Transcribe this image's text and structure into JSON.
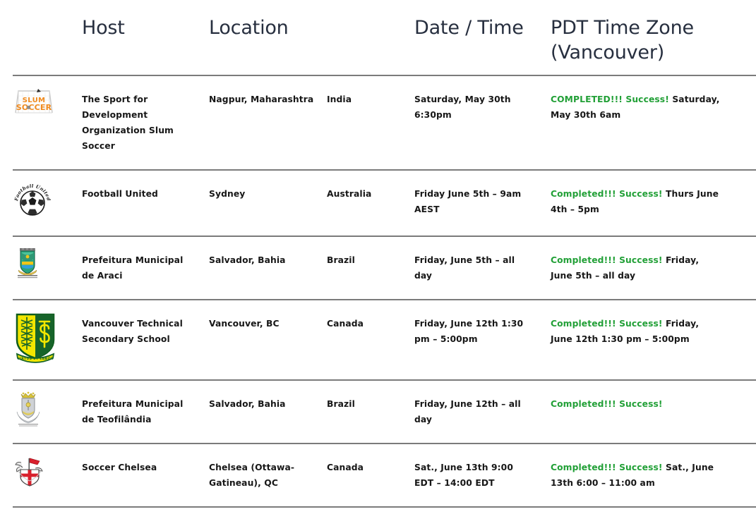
{
  "table": {
    "columns": [
      {
        "key": "logo",
        "label": ""
      },
      {
        "key": "host",
        "label": "Host"
      },
      {
        "key": "location",
        "label": "Location"
      },
      {
        "key": "country",
        "label": ""
      },
      {
        "key": "datetime",
        "label": "Date / Time"
      },
      {
        "key": "pdt",
        "label": "PDT Time Zone (Vancouver)"
      }
    ],
    "headers": {
      "logo": "",
      "host": "Host",
      "location": "Location",
      "country": "",
      "datetime": "Date / Time",
      "pdt": "PDT Time Zone (Vancouver)"
    },
    "rows": [
      {
        "logo_name": "slum-soccer-logo",
        "logo_alt": "Slum Soccer",
        "host": "The Sport for Development Organization Slum Soccer",
        "location": "Nagpur, Maharashtra",
        "country": "India",
        "datetime": "Saturday, May 30th 6:30pm",
        "pdt_status": "COMPLETED!!! Success!",
        "pdt_detail": " Saturday, May 30th 6am"
      },
      {
        "logo_name": "football-united-logo",
        "logo_alt": "Football United",
        "host": "Football United",
        "location": "Sydney",
        "country": "Australia",
        "datetime": "Friday June 5th – 9am AEST",
        "pdt_status": "Completed!!! Success!",
        "pdt_detail": " Thurs June 4th – 5pm"
      },
      {
        "logo_name": "prefeitura-araci-logo",
        "logo_alt": "Prefeitura Municipal de Araci",
        "host": "Prefeitura Municipal de Araci",
        "location": "Salvador, Bahia",
        "country": "Brazil",
        "datetime": "Friday, June 5th – all day",
        "pdt_status": "Completed!!! Success!",
        "pdt_detail": " Friday, June 5th – all day"
      },
      {
        "logo_name": "vancouver-technical-logo",
        "logo_alt": "Vancouver Technical Secondary School",
        "host": "Vancouver Technical Secondary School",
        "location": "Vancouver, BC",
        "country": "Canada",
        "datetime": "Friday, June 12th 1:30 pm – 5:00pm",
        "pdt_status": "Completed!!! Success!",
        "pdt_detail": " Friday, June 12th 1:30 pm – 5:00pm"
      },
      {
        "logo_name": "prefeitura-teofilandia-logo",
        "logo_alt": "Prefeitura Municipal de Teofilândia",
        "host": "Prefeitura Municipal de Teofilândia",
        "location": "Salvador, Bahia",
        "country": "Brazil",
        "datetime": "Friday, June 12th – all day",
        "pdt_status": "Completed!!! Success!",
        "pdt_detail": ""
      },
      {
        "logo_name": "soccer-chelsea-logo",
        "logo_alt": "Soccer Chelsea",
        "host": "Soccer Chelsea",
        "location": "Chelsea (Ottawa-Gatineau), QC",
        "country": "Canada",
        "datetime": "Sat., June 13th 9:00 EDT – 14:00 EDT",
        "pdt_status": "Completed!!! Success!",
        "pdt_detail": " Sat., June 13th 6:00 – 11:00 am"
      }
    ]
  },
  "colors": {
    "success": "#22a037",
    "text": "#171717",
    "header_text": "#272f3f",
    "rule": "#7b7b7b",
    "background": "#ffffff"
  }
}
